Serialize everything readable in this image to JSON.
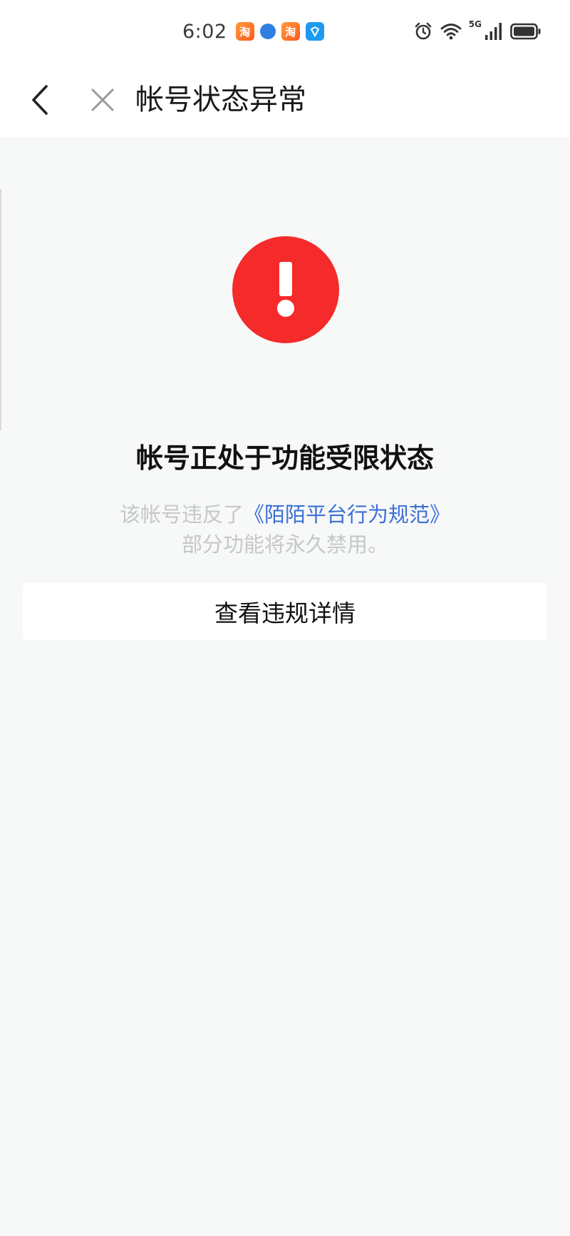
{
  "status_bar": {
    "time": "6:02",
    "app_icons": [
      "taobao-icon",
      "browser-ball-icon",
      "taobao-icon",
      "alipay-icon"
    ],
    "network_label": "5G",
    "right_icons": [
      "alarm-clock-icon",
      "wifi-icon",
      "cellular-signal-icon",
      "battery-icon"
    ]
  },
  "nav": {
    "title": "帐号状态异常"
  },
  "alert": {
    "color": "#f52a2a"
  },
  "content": {
    "headline": "帐号正处于功能受限状态",
    "desc_prefix": "该帐号违反了",
    "desc_link": "《陌陌平台行为规范》",
    "desc_line2": "部分功能将永久禁用。"
  },
  "actions": {
    "view_details_label": "查看违规详情"
  }
}
